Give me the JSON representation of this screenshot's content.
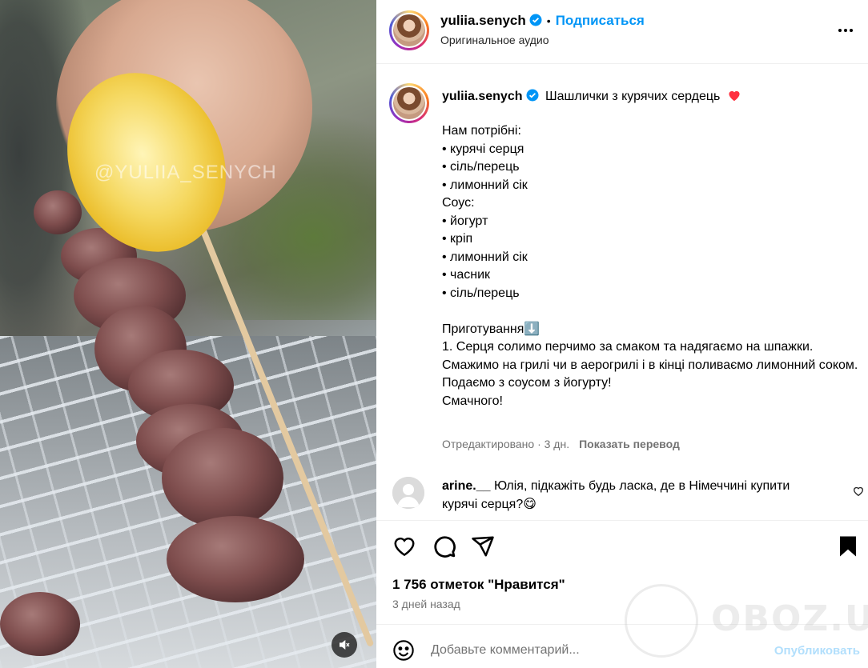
{
  "header": {
    "username": "yuliia.senych",
    "follow_label": "Подписаться",
    "subtitle": "Оригинальное аудио"
  },
  "video": {
    "watermark": "@YULIIA_SENYCH"
  },
  "caption": {
    "username": "yuliia.senych",
    "title": "Шашлички з курячих сердець",
    "body": "Нам потрібні:\n• курячі серця\n• сіль/перець\n• лимонний сік\nСоус:\n• йогурт\n• кріп\n• лимонний сік\n• часник\n• сіль/перець\n\nПриготування⬇️\n1. Серця солимо перчимо за смаком та надягаємо на шпажки.\nСмажимо на грилі чи в аерогрилі і в кінці поливаємо лимонний соком.\nПодаємо з соусом з йогурту!\nСмачного!",
    "edited": "Отредактировано · 3 дн.",
    "translate": "Показать перевод"
  },
  "comment": {
    "username": "arine.__",
    "text": "Юлія, підкажіть будь ласка, де в Німеччині купити курячі серця?😋"
  },
  "stats": {
    "likes": "1 756 отметок \"Нравится\"",
    "time": "3 дней назад"
  },
  "composer": {
    "placeholder": "Добавьте комментарий...",
    "publish_label": "Опубликовать"
  },
  "site_watermark": "OBOZ.UA",
  "icons": [
    "verified-icon",
    "more-icon",
    "heart-icon",
    "comment-icon",
    "share-icon",
    "bookmark-icon",
    "emoji-icon",
    "mute-icon"
  ],
  "colors": {
    "accent": "#0095f6",
    "muted": "#737373",
    "publish_disabled": "#b2dffc",
    "heart_red": "#ff3040"
  }
}
